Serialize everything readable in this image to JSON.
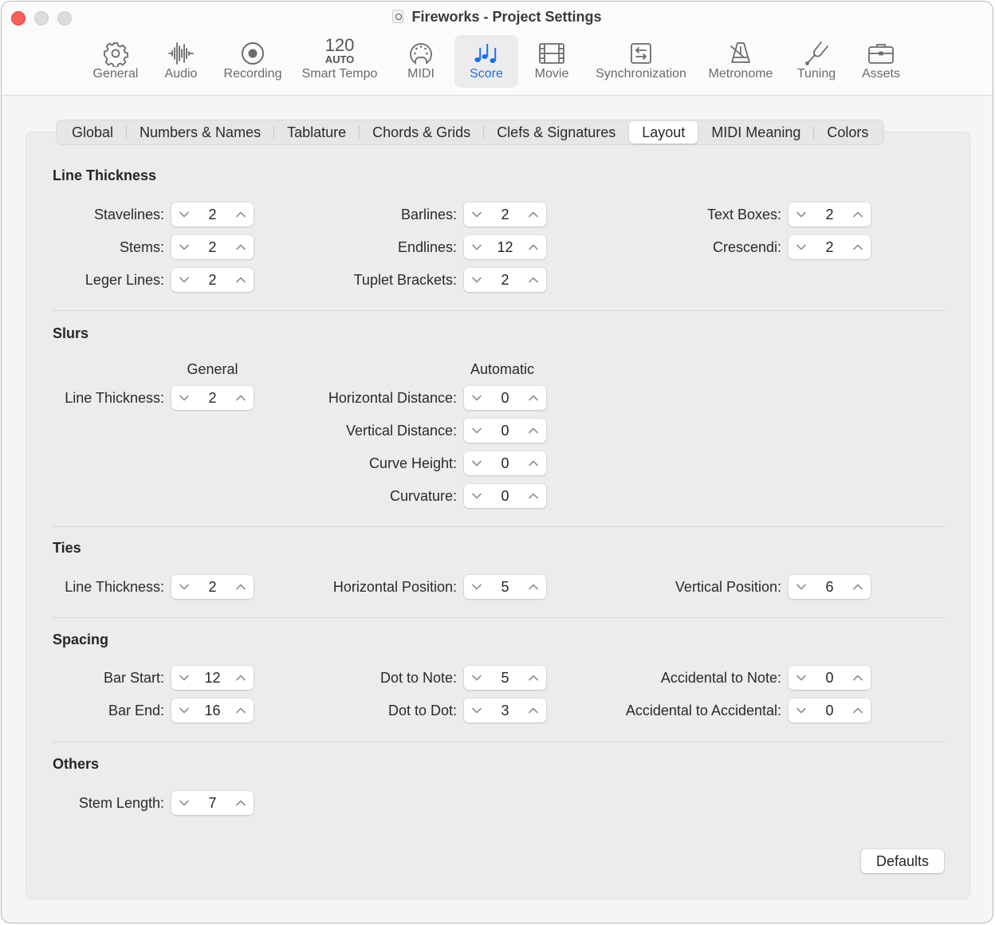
{
  "window": {
    "title": "Fireworks - Project Settings"
  },
  "toolbar": {
    "items": [
      {
        "id": "general",
        "label": "General",
        "icon": "gear-icon"
      },
      {
        "id": "audio",
        "label": "Audio",
        "icon": "waveform-icon"
      },
      {
        "id": "recording",
        "label": "Recording",
        "icon": "record-icon"
      },
      {
        "id": "smart-tempo",
        "label": "Smart Tempo",
        "icon": "tempo-readout",
        "tempo": "120",
        "mode": "AUTO"
      },
      {
        "id": "midi",
        "label": "MIDI",
        "icon": "midi-port-icon"
      },
      {
        "id": "score",
        "label": "Score",
        "icon": "music-notes-icon",
        "active": true
      },
      {
        "id": "movie",
        "label": "Movie",
        "icon": "film-icon"
      },
      {
        "id": "synchronization",
        "label": "Synchronization",
        "icon": "sync-arrows-icon"
      },
      {
        "id": "metronome",
        "label": "Metronome",
        "icon": "metronome-icon"
      },
      {
        "id": "tuning",
        "label": "Tuning",
        "icon": "tuning-fork-icon"
      },
      {
        "id": "assets",
        "label": "Assets",
        "icon": "briefcase-icon"
      }
    ],
    "accent_color": "#1a6ef5"
  },
  "tabs": [
    {
      "label": "Global"
    },
    {
      "label": "Numbers & Names"
    },
    {
      "label": "Tablature"
    },
    {
      "label": "Chords & Grids"
    },
    {
      "label": "Clefs & Signatures"
    },
    {
      "label": "Layout",
      "active": true
    },
    {
      "label": "MIDI Meaning"
    },
    {
      "label": "Colors"
    }
  ],
  "sections": {
    "line_thickness": {
      "title": "Line Thickness",
      "fields": {
        "stavelines": {
          "label": "Stavelines:",
          "value": "2"
        },
        "stems": {
          "label": "Stems:",
          "value": "2"
        },
        "leger_lines": {
          "label": "Leger Lines:",
          "value": "2"
        },
        "barlines": {
          "label": "Barlines:",
          "value": "2"
        },
        "endlines": {
          "label": "Endlines:",
          "value": "12"
        },
        "tuplet_brackets": {
          "label": "Tuplet Brackets:",
          "value": "2"
        },
        "text_boxes": {
          "label": "Text Boxes:",
          "value": "2"
        },
        "crescendi": {
          "label": "Crescendi:",
          "value": "2"
        }
      }
    },
    "slurs": {
      "title": "Slurs",
      "general_heading": "General",
      "automatic_heading": "Automatic",
      "fields": {
        "line_thickness": {
          "label": "Line Thickness:",
          "value": "2"
        },
        "horizontal_distance": {
          "label": "Horizontal Distance:",
          "value": "0"
        },
        "vertical_distance": {
          "label": "Vertical Distance:",
          "value": "0"
        },
        "curve_height": {
          "label": "Curve Height:",
          "value": "0"
        },
        "curvature": {
          "label": "Curvature:",
          "value": "0"
        }
      }
    },
    "ties": {
      "title": "Ties",
      "fields": {
        "line_thickness": {
          "label": "Line Thickness:",
          "value": "2"
        },
        "horizontal_position": {
          "label": "Horizontal Position:",
          "value": "5"
        },
        "vertical_position": {
          "label": "Vertical Position:",
          "value": "6"
        }
      }
    },
    "spacing": {
      "title": "Spacing",
      "fields": {
        "bar_start": {
          "label": "Bar Start:",
          "value": "12"
        },
        "bar_end": {
          "label": "Bar End:",
          "value": "16"
        },
        "dot_to_note": {
          "label": "Dot to Note:",
          "value": "5"
        },
        "dot_to_dot": {
          "label": "Dot to Dot:",
          "value": "3"
        },
        "accidental_to_note": {
          "label": "Accidental to Note:",
          "value": "0"
        },
        "accidental_to_accidental": {
          "label": "Accidental to Accidental:",
          "value": "0"
        }
      }
    },
    "others": {
      "title": "Others",
      "fields": {
        "stem_length": {
          "label": "Stem Length:",
          "value": "7"
        }
      }
    }
  },
  "buttons": {
    "defaults": "Defaults"
  }
}
